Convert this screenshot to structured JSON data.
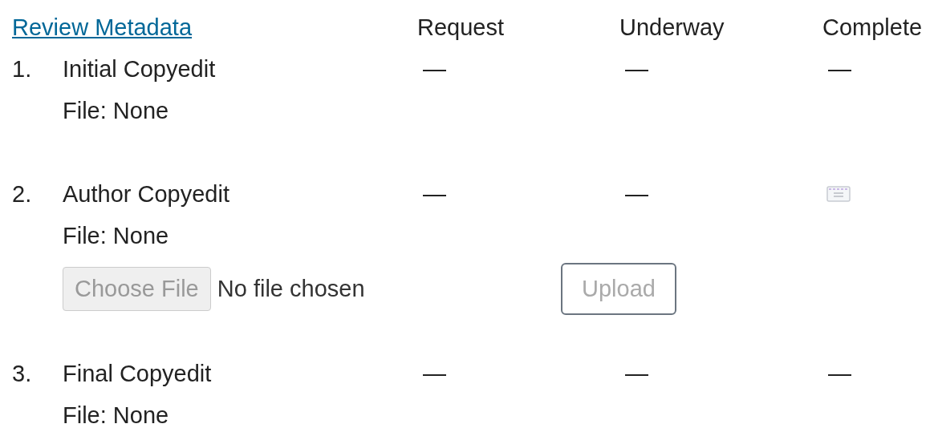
{
  "header": {
    "link": "Review Metadata",
    "columns": [
      "Request",
      "Underway",
      "Complete"
    ]
  },
  "steps": [
    {
      "number": "1.",
      "title": "Initial Copyedit",
      "file": "File: None",
      "cells": [
        {
          "kind": "dash",
          "text": "—"
        },
        {
          "kind": "dash",
          "text": "—"
        },
        {
          "kind": "dash",
          "text": "—"
        }
      ]
    },
    {
      "number": "2.",
      "title": "Author Copyedit",
      "file": "File: None",
      "cells": [
        {
          "kind": "dash",
          "text": "—"
        },
        {
          "kind": "dash",
          "text": "—"
        },
        {
          "kind": "icon"
        }
      ],
      "upload": {
        "choose": "Choose File",
        "status": "No file chosen",
        "submit": "Upload",
        "disabled": true
      }
    },
    {
      "number": "3.",
      "title": "Final Copyedit",
      "file": "File: None",
      "cells": [
        {
          "kind": "dash",
          "text": "—"
        },
        {
          "kind": "dash",
          "text": "—"
        },
        {
          "kind": "dash",
          "text": "—"
        }
      ]
    }
  ]
}
